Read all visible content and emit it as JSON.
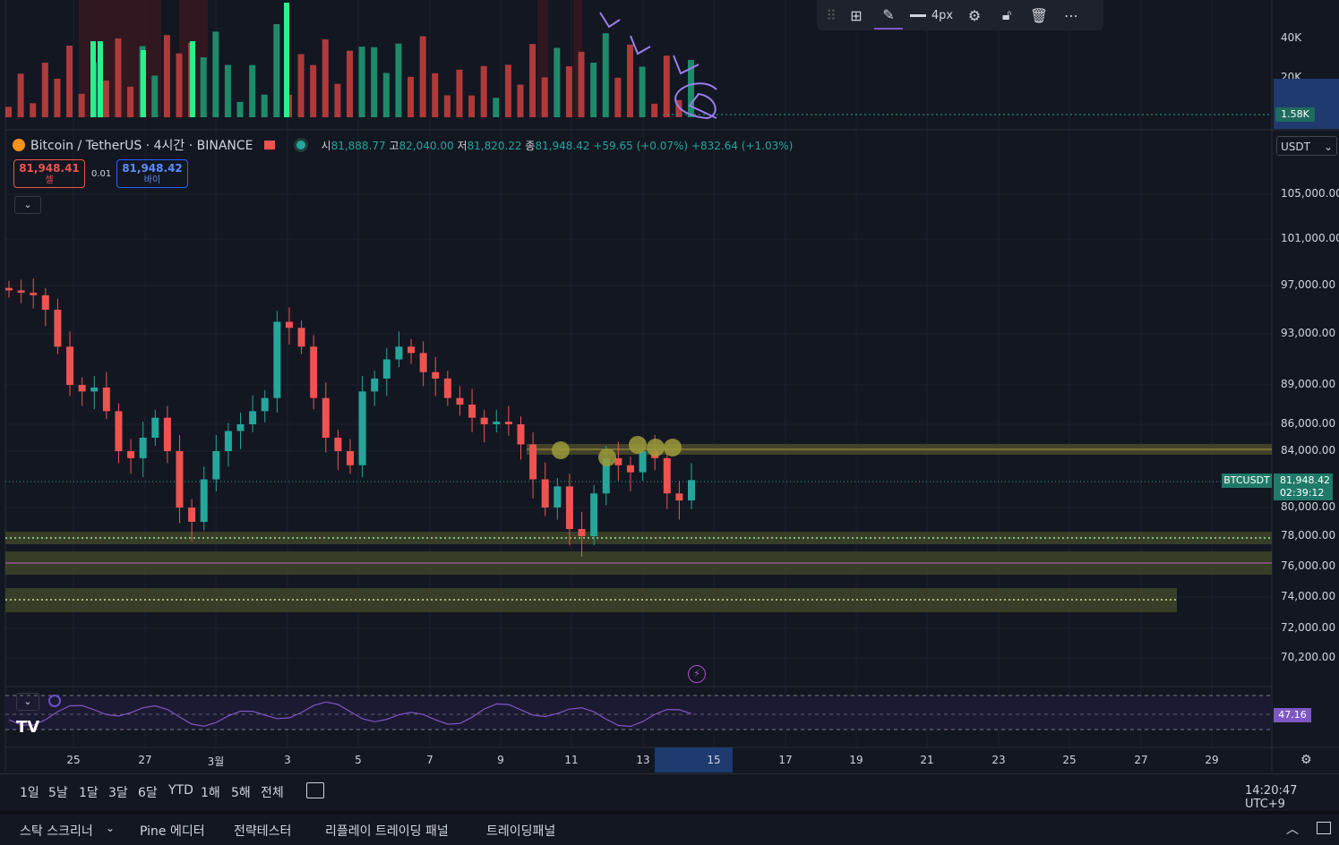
{
  "toolbar": {
    "items": [
      {
        "name": "drag-handle-icon"
      },
      {
        "name": "template-icon"
      },
      {
        "name": "pencil-icon"
      },
      {
        "name": "line-width-icon",
        "label": "4px"
      },
      {
        "name": "settings-icon"
      },
      {
        "name": "unlock-icon"
      },
      {
        "name": "trash-icon"
      },
      {
        "name": "more-icon"
      }
    ],
    "width_label": "4px"
  },
  "legend": {
    "symbol": "Bitcoin / TetherUS · 4시간 · BINANCE",
    "open_label": "시",
    "open": "81,888.77",
    "high_label": "고",
    "high": "82,040.00",
    "low_label": "저",
    "low": "81,820.22",
    "close_label": "종",
    "close": "81,948.42",
    "change": "+59.65 (+0.07%)",
    "change2": "+832.64 (+1.03%)"
  },
  "trade": {
    "sell_price": "81,948.41",
    "sell_label": "셀",
    "qty": "0.01",
    "buy_price": "81,948.42",
    "buy_label": "바이"
  },
  "currency": "USDT",
  "volume_axis": {
    "labels": [
      "40K",
      "20K"
    ],
    "current": "1.58K"
  },
  "price_axis": {
    "labels": [
      "105,000.00",
      "101,000.00",
      "97,000.00",
      "93,000.00",
      "89,000.00",
      "86,000.00",
      "84,000.00",
      "80,000.00",
      "78,000.00",
      "76,000.00",
      "74,000.00",
      "72,000.00",
      "70,200.00"
    ],
    "symbol_tag": "BTCUSDT",
    "last_price": "81,948.42",
    "countdown": "02:39:12"
  },
  "rsi": {
    "value": "47.16"
  },
  "x_axis": {
    "labels": [
      "25",
      "27",
      "3월",
      "3",
      "5",
      "7",
      "9",
      "11",
      "13",
      "15",
      "17",
      "19",
      "21",
      "23",
      "25",
      "27",
      "29"
    ],
    "highlight": "15"
  },
  "ranges": [
    "1일",
    "5날",
    "1달",
    "3달",
    "6달",
    "YTD",
    "1해",
    "5해",
    "전체"
  ],
  "clock": "14:20:47 UTC+9",
  "bottom_tabs": [
    "스탁 스크리너",
    "Pine 에디터",
    "전략테스터",
    "리플레이 트레이딩 패널",
    "트레이딩패널"
  ],
  "colors": {
    "up": "#26a69a",
    "down": "#ef5350",
    "bg": "#131722",
    "rsi": "#7e57c2",
    "zone": "#4a4a2a"
  },
  "chart_data": {
    "type": "candlestick",
    "symbol": "BTCUSDT",
    "interval": "4시간",
    "y_range": [
      70200,
      105000
    ],
    "close_approx": [
      96600,
      96400,
      96200,
      95000,
      92000,
      89000,
      88500,
      88800,
      87000,
      84000,
      83500,
      85000,
      86500,
      84000,
      80000,
      79000,
      82000,
      84000,
      85500,
      86000,
      87000,
      88000,
      94000,
      93500,
      92000,
      88000,
      85000,
      84000,
      83000,
      88500,
      89500,
      91000,
      92000,
      91500,
      90000,
      89500,
      88000,
      87500,
      86500,
      86000,
      86200,
      86000,
      84500,
      82000,
      80000,
      81500,
      78500,
      78000,
      81000,
      83500,
      83000,
      82500,
      84000,
      83500,
      81000,
      80500,
      81948
    ]
  }
}
